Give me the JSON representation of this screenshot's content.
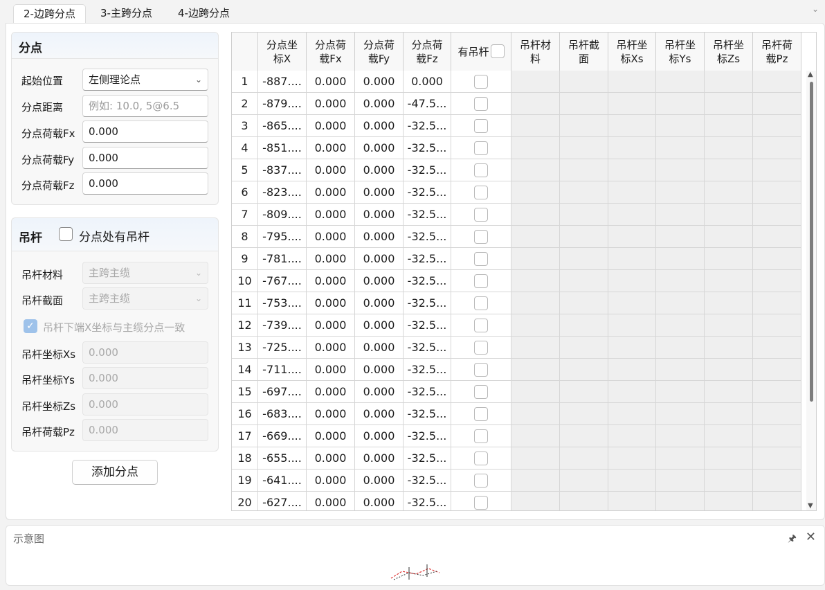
{
  "tabs": [
    {
      "label": "2-边跨分点",
      "active": true
    },
    {
      "label": "3-主跨分点",
      "active": false
    },
    {
      "label": "4-边跨分点",
      "active": false
    }
  ],
  "fendian": {
    "title": "分点",
    "start_label": "起始位置",
    "start_value": "左侧理论点",
    "dist_label": "分点距离",
    "dist_placeholder": "例如: 10.0, 5@6.5",
    "fx_label": "分点荷载Fx",
    "fx_value": "0.000",
    "fy_label": "分点荷载Fy",
    "fy_value": "0.000",
    "fz_label": "分点荷载Fz",
    "fz_value": "0.000"
  },
  "diaogan": {
    "title": "吊杆",
    "has_label": "分点处有吊杆",
    "material_label": "吊杆材料",
    "material_value": "主跨主缆",
    "section_label": "吊杆截面",
    "section_value": "主跨主缆",
    "align_label": "吊杆下端X坐标与主缆分点一致",
    "xs_label": "吊杆坐标Xs",
    "xs_value": "0.000",
    "ys_label": "吊杆坐标Ys",
    "ys_value": "0.000",
    "zs_label": "吊杆坐标Zs",
    "zs_value": "0.000",
    "pz_label": "吊杆荷载Pz",
    "pz_value": "0.000"
  },
  "add_button": "添加分点",
  "table": {
    "headers": [
      "",
      "分点坐\n标X",
      "分点荷\n载Fx",
      "分点荷\n载Fy",
      "分点荷\n载Fz",
      "有吊杆",
      "吊杆材\n料",
      "吊杆截\n面",
      "吊杆坐\n标Xs",
      "吊杆坐\n标Ys",
      "吊杆坐\n标Zs",
      "吊杆荷\n载Pz"
    ],
    "rows": [
      [
        "1",
        "-887....",
        "0.000",
        "0.000",
        "0.000"
      ],
      [
        "2",
        "-879....",
        "0.000",
        "0.000",
        "-47.5..."
      ],
      [
        "3",
        "-865....",
        "0.000",
        "0.000",
        "-32.5..."
      ],
      [
        "4",
        "-851....",
        "0.000",
        "0.000",
        "-32.5..."
      ],
      [
        "5",
        "-837....",
        "0.000",
        "0.000",
        "-32.5..."
      ],
      [
        "6",
        "-823....",
        "0.000",
        "0.000",
        "-32.5..."
      ],
      [
        "7",
        "-809....",
        "0.000",
        "0.000",
        "-32.5..."
      ],
      [
        "8",
        "-795....",
        "0.000",
        "0.000",
        "-32.5..."
      ],
      [
        "9",
        "-781....",
        "0.000",
        "0.000",
        "-32.5..."
      ],
      [
        "10",
        "-767....",
        "0.000",
        "0.000",
        "-32.5..."
      ],
      [
        "11",
        "-753....",
        "0.000",
        "0.000",
        "-32.5..."
      ],
      [
        "12",
        "-739....",
        "0.000",
        "0.000",
        "-32.5..."
      ],
      [
        "13",
        "-725....",
        "0.000",
        "0.000",
        "-32.5..."
      ],
      [
        "14",
        "-711....",
        "0.000",
        "0.000",
        "-32.5..."
      ],
      [
        "15",
        "-697....",
        "0.000",
        "0.000",
        "-32.5..."
      ],
      [
        "16",
        "-683....",
        "0.000",
        "0.000",
        "-32.5..."
      ],
      [
        "17",
        "-669....",
        "0.000",
        "0.000",
        "-32.5..."
      ],
      [
        "18",
        "-655....",
        "0.000",
        "0.000",
        "-32.5..."
      ],
      [
        "19",
        "-641....",
        "0.000",
        "0.000",
        "-32.5..."
      ],
      [
        "20",
        "-627....",
        "0.000",
        "0.000",
        "-32.5..."
      ]
    ]
  },
  "diagram": {
    "title": "示意图"
  }
}
